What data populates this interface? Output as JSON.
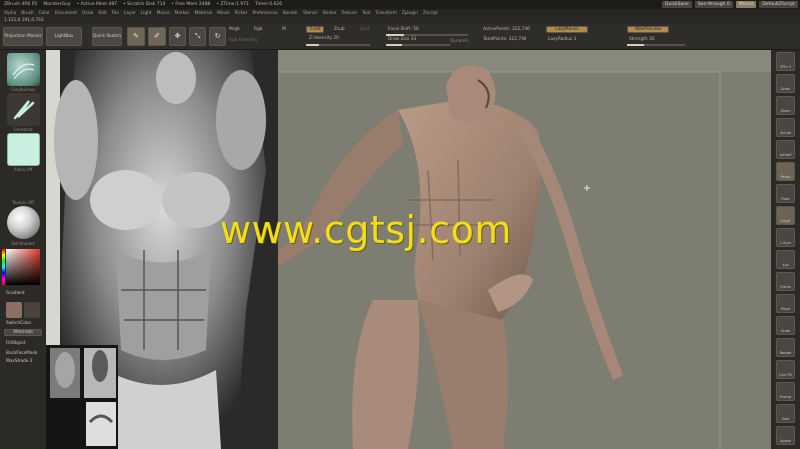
{
  "titlebar": {
    "items": [
      "ZBrush 4R6 P2",
      "MonsterGuy",
      "• Active Mem 487",
      "• Scratch Disk 714",
      "• Free Mem 2488",
      "• ZTime:1.971",
      "Timer:0.626"
    ],
    "quicksave": "QuickSave",
    "seethrough": "See-through",
    "seethrough_val": "0",
    "menus_btn": "Menus",
    "script_btn": "DefaultZScript"
  },
  "menubar": {
    "items": [
      "Alpha",
      "Brush",
      "Color",
      "Document",
      "Draw",
      "Edit",
      "File",
      "Layer",
      "Light",
      "Macro",
      "Marker",
      "Material",
      "Movie",
      "Picker",
      "Preferences",
      "Render",
      "Stencil",
      "Stroke",
      "Texture",
      "Tool",
      "Transform",
      "Zplugin",
      "Zscript"
    ]
  },
  "coords": "1.121,0.191,0.763",
  "shelf": {
    "projection_master": "Projection Master",
    "lightbox": "LightBox",
    "quick_sketch": "Quick Sketch",
    "edit": "Edit",
    "draw": "Draw",
    "move": "Move",
    "scale": "Scale",
    "rotate": "Rotate",
    "mrgb": "Mrgb",
    "rgb": "Rgb",
    "m": "M",
    "rgb_intensity": "Rgb Intensity",
    "zadd": "Zadd",
    "zsub": "Zsub",
    "zcut": "Zcut",
    "z_intensity_label": "Z Intensity",
    "z_intensity_value": "20",
    "z_intensity_fraction": 0.2,
    "focal_shift_label": "Focal Shift",
    "focal_shift_value": "-56",
    "focal_shift_fraction": 0.22,
    "draw_size_label": "Draw Size",
    "draw_size_value": "33",
    "draw_size_fraction": 0.25,
    "dynamic": "Dynamic",
    "active_points_label": "ActivePoints:",
    "active_points_value": "322,746",
    "total_points_label": "TotalPoints:",
    "total_points_value": "322,746",
    "lazy_mouse": "LazyMouse",
    "lazy_radius_label": "LazyRadius",
    "lazy_radius_value": "1",
    "wax_preview": "WaxPreview",
    "strength_label": "Strength",
    "strength_value": "30",
    "strength_fraction": 0.3
  },
  "leftpanel": {
    "brush_label": "ClayBuildup",
    "stroke_label": "FreeHand",
    "alpha_label": "Alpha Off",
    "texture_label": "Texture Off",
    "material_label": "SkinShade4",
    "gradient": "Gradient",
    "switch_color": "SwitchColor",
    "alternate": "Alternate",
    "fill_object": "FillObject",
    "backface_mask": "BackFaceMask",
    "maxshade_label": "MaxShade",
    "maxshade_value": "2"
  },
  "rightpanel": {
    "buttons": [
      "SPix 3",
      "Scroll",
      "Zoom",
      "Actual",
      "AAHalf",
      "Persp",
      "Floor",
      "Local",
      "L.Sym",
      "Xyz",
      "Frame",
      "Move",
      "Scale",
      "Rotate",
      "Line Fill",
      "Transp",
      "Solo",
      "Xpose"
    ]
  },
  "watermark": "www.cgtsj.com",
  "colors": {
    "viewport_bg": "#7d7d72",
    "panel_bg": "#2c2a27",
    "accent_orange": "#b08b4f",
    "watermark": "#f2dc1e",
    "model_skin": "#9e8271"
  }
}
